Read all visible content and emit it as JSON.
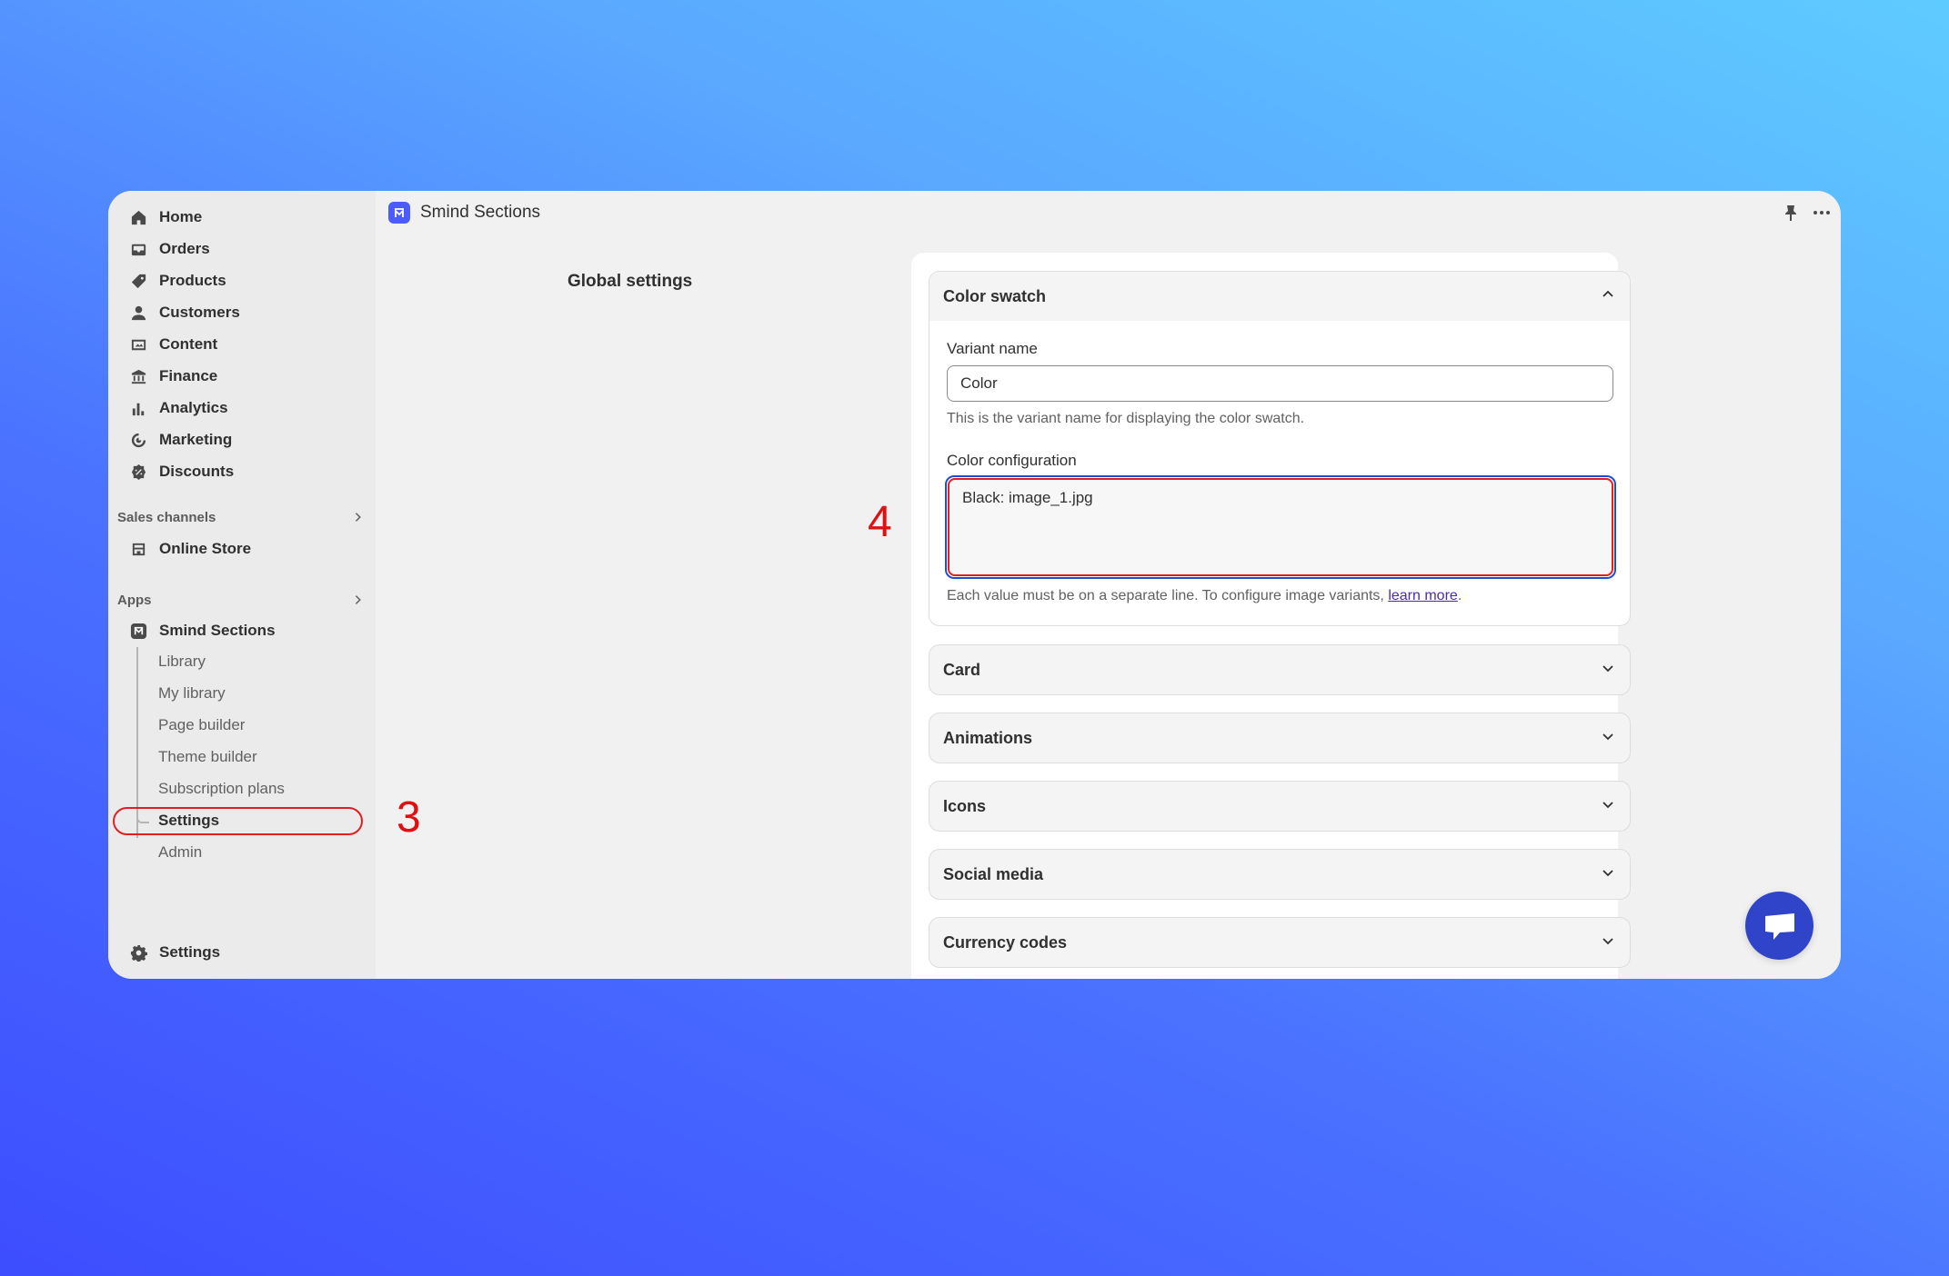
{
  "topbar": {
    "app_title": "Smind Sections"
  },
  "sidebar": {
    "items": [
      {
        "label": "Home",
        "icon": "home-icon"
      },
      {
        "label": "Orders",
        "icon": "inbox-icon"
      },
      {
        "label": "Products",
        "icon": "tag-icon"
      },
      {
        "label": "Customers",
        "icon": "person-icon"
      },
      {
        "label": "Content",
        "icon": "image-icon"
      },
      {
        "label": "Finance",
        "icon": "bank-icon"
      },
      {
        "label": "Analytics",
        "icon": "bar-chart-icon"
      },
      {
        "label": "Marketing",
        "icon": "target-icon"
      },
      {
        "label": "Discounts",
        "icon": "discount-icon"
      }
    ],
    "sales_channels": {
      "label": "Sales channels",
      "online_store": "Online Store"
    },
    "apps": {
      "label": "Apps",
      "app_name": "Smind Sections",
      "subitems": [
        "Library",
        "My library",
        "Page builder",
        "Theme builder",
        "Subscription plans",
        "Settings",
        "Admin"
      ]
    },
    "settings": "Settings"
  },
  "main": {
    "global_title": "Global settings",
    "color_swatch": {
      "title": "Color swatch",
      "variant_label": "Variant name",
      "variant_value": "Color",
      "variant_help": "This is the variant name for displaying the color swatch.",
      "config_label": "Color configuration",
      "config_value": "Black: image_1.jpg",
      "config_help_prefix": "Each value must be on a separate line. To configure image variants, ",
      "config_help_link": "learn more",
      "config_help_suffix": "."
    },
    "sections": [
      "Card",
      "Animations",
      "Icons",
      "Social media",
      "Currency codes"
    ]
  },
  "annotations": {
    "step_3": "3",
    "step_4": "4"
  },
  "colors": {
    "accent": "#4b5bff",
    "highlight": "#e02020",
    "chat": "#2f44c8"
  }
}
